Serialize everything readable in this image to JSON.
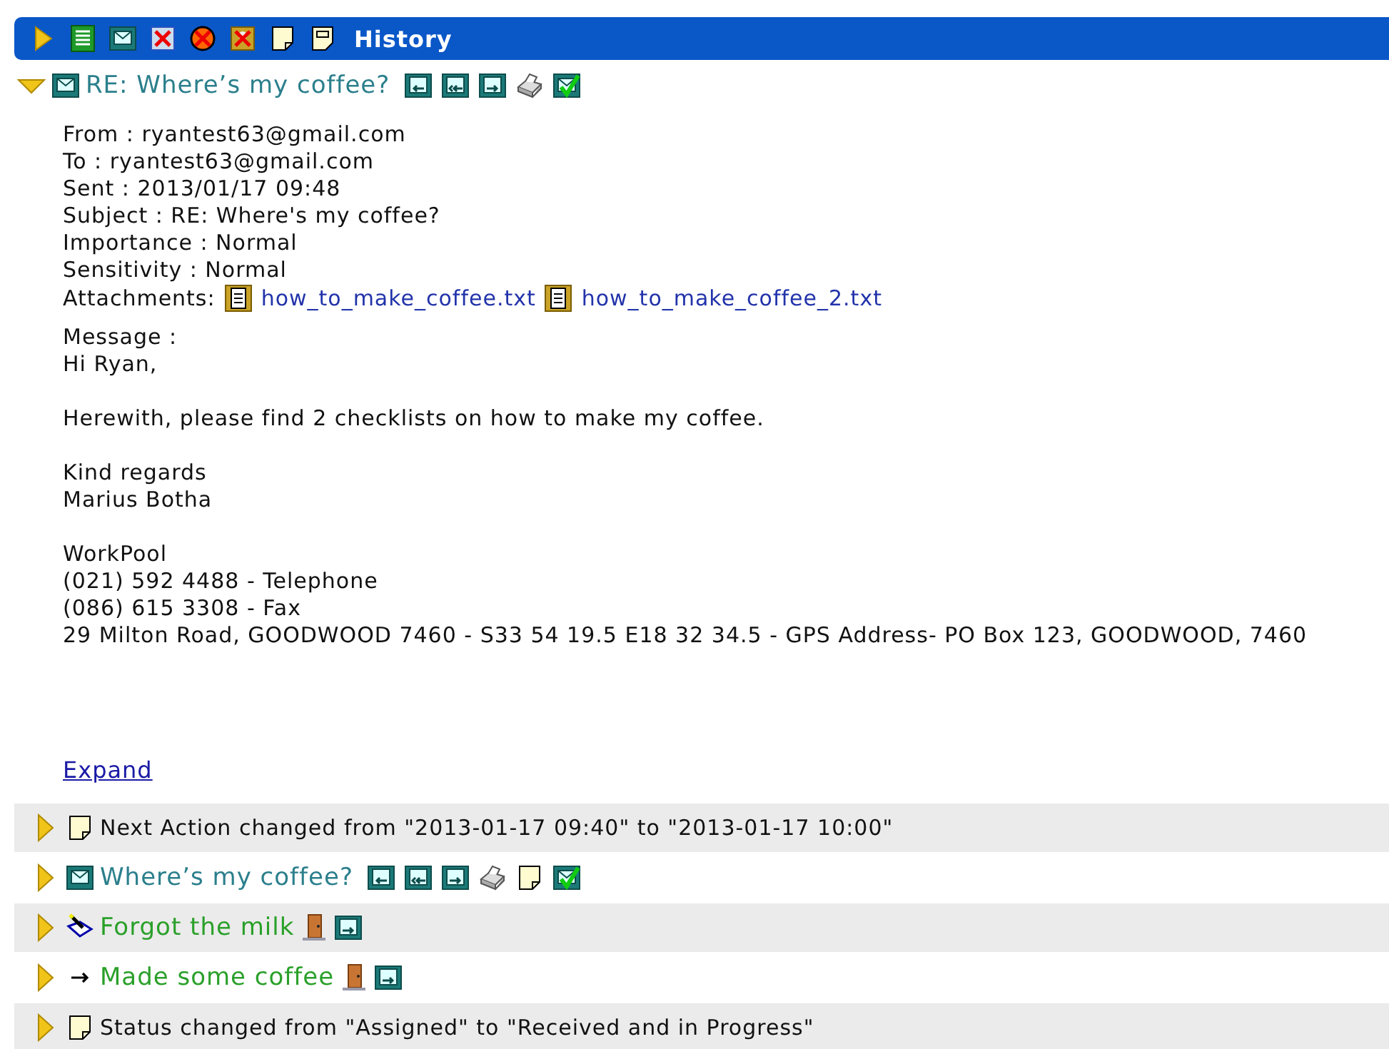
{
  "toolbar": {
    "title": "History",
    "buttons": [
      {
        "kind": "play"
      },
      {
        "kind": "list"
      },
      {
        "kind": "mail"
      },
      {
        "kind": "delete-form"
      },
      {
        "kind": "cancel"
      },
      {
        "kind": "delete-person"
      },
      {
        "kind": "note"
      },
      {
        "kind": "memo"
      }
    ]
  },
  "entries": [
    {
      "kind": "email",
      "expanded": true,
      "title": "RE: Where’s my coffee?",
      "actions": [
        {
          "kind": "reply"
        },
        {
          "kind": "reply-all"
        },
        {
          "kind": "forward"
        },
        {
          "kind": "print"
        },
        {
          "kind": "done"
        }
      ],
      "details": {
        "fields": [
          "From : ryantest63@gmail.com",
          "To : ryantest63@gmail.com",
          "Sent :  2013/01/17 09:48",
          "Subject : RE: Where's my coffee?",
          "Importance : Normal",
          "Sensitivity : Normal"
        ],
        "attachments_label": "Attachments:",
        "attachments": [
          "how_to_make_coffee.txt",
          "how_to_make_coffee_2.txt"
        ],
        "message_label": "Message :",
        "message_paragraphs": [
          [
            "Hi Ryan,"
          ],
          [
            "Herewith, please find 2 checklists on how to make my coffee."
          ],
          [
            "Kind regards",
            "Marius Botha"
          ],
          [
            "WorkPool",
            "(021) 592 4488 - Telephone",
            "(086) 615 3308 - Fax",
            "29 Milton Road, GOODWOOD 7460 - S33 54 19.5 E18 32 34.5 - GPS Address- PO Box 123, GOODWOOD, 7460"
          ]
        ],
        "expand_link": "Expand"
      }
    },
    {
      "kind": "note",
      "expanded": false,
      "title": "Next Action changed from \"2013-01-17 09:40\" to \"2013-01-17 10:00\""
    },
    {
      "kind": "email",
      "expanded": false,
      "title": "Where’s my coffee?",
      "actions": [
        {
          "kind": "reply"
        },
        {
          "kind": "reply-all"
        },
        {
          "kind": "forward"
        },
        {
          "kind": "print"
        },
        {
          "kind": "note"
        },
        {
          "kind": "done"
        }
      ]
    },
    {
      "kind": "task",
      "expanded": false,
      "title": "Forgot the milk",
      "actions": [
        {
          "kind": "door"
        },
        {
          "kind": "forward"
        }
      ]
    },
    {
      "kind": "step",
      "expanded": false,
      "title": "Made some coffee",
      "actions": [
        {
          "kind": "door"
        },
        {
          "kind": "forward"
        }
      ]
    },
    {
      "kind": "note",
      "expanded": false,
      "title": "Status changed from \"Assigned\" to \"Received and in Progress\""
    }
  ]
}
